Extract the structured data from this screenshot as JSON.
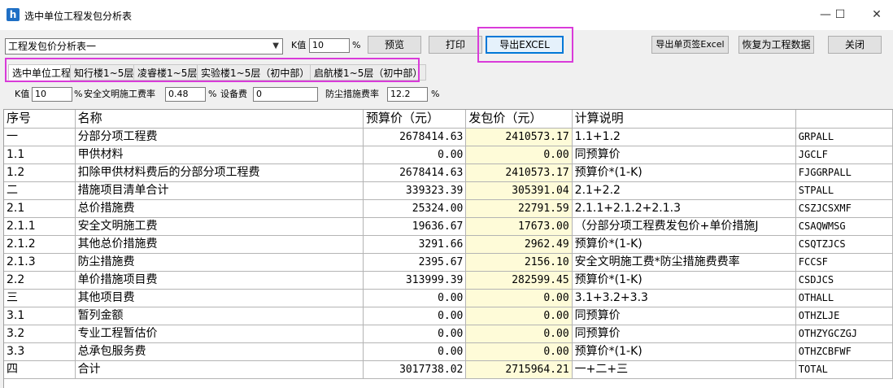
{
  "window": {
    "title": "选中单位工程发包分析表",
    "minimize": "—",
    "maximize": "☐",
    "close": "✕"
  },
  "toolbar": {
    "select_value": "工程发包价分析表一",
    "k_label": "K值",
    "k_value": "10",
    "percent": "%",
    "preview": "预览",
    "print": "打印",
    "export_excel": "导出EXCEL",
    "export_single_excel": "导出单页签Excel",
    "restore": "恢复为工程数据",
    "close": "关闭"
  },
  "tabs": [
    {
      "label": "选中单位工程",
      "active": true
    },
    {
      "label": "知行楼1~5层",
      "active": false
    },
    {
      "label": "凌睿楼1~5层",
      "active": false
    },
    {
      "label": "实验楼1~5层（初中部）",
      "active": false
    },
    {
      "label": "启航楼1~5层（初中部）",
      "active": false
    }
  ],
  "params": {
    "k_label": "K值",
    "k_value": "10",
    "percent": "%",
    "safety_label": "安全文明施工费率",
    "safety_value": "0.48",
    "equip_label": "设备费",
    "equip_value": "0",
    "dust_label": "防尘措施费率",
    "dust_value": "12.2"
  },
  "table": {
    "headers": [
      "序号",
      "名称",
      "预算价（元）",
      "发包价（元）",
      "计算说明",
      ""
    ],
    "rows": [
      [
        "一",
        "分部分项工程费",
        "2678414.63",
        "2410573.17",
        "1.1+1.2",
        "GRPALL"
      ],
      [
        "1.1",
        "甲供材料",
        "0.00",
        "0.00",
        "同预算价",
        "JGCLF"
      ],
      [
        "1.2",
        "扣除甲供材料费后的分部分项工程费",
        "2678414.63",
        "2410573.17",
        "预算价*(1-K)",
        "FJGGRPALL"
      ],
      [
        "二",
        "措施项目清单合计",
        "339323.39",
        "305391.04",
        "2.1+2.2",
        "STPALL"
      ],
      [
        "2.1",
        "总价措施费",
        "25324.00",
        "22791.59",
        "2.1.1+2.1.2+2.1.3",
        "CSZJCSXMF"
      ],
      [
        "2.1.1",
        "安全文明施工费",
        "19636.67",
        "17673.00",
        "（分部分项工程费发包价+单价措施J",
        "CSAQWMSG"
      ],
      [
        "2.1.2",
        "其他总价措施费",
        "3291.66",
        "2962.49",
        "预算价*(1-K)",
        "CSQTZJCS"
      ],
      [
        "2.1.3",
        "防尘措施费",
        "2395.67",
        "2156.10",
        "安全文明施工费*防尘措施费费率",
        "FCCSF"
      ],
      [
        "2.2",
        "单价措施项目费",
        "313999.39",
        "282599.45",
        "预算价*(1-K)",
        "CSDJCS"
      ],
      [
        "三",
        "其他项目费",
        "0.00",
        "0.00",
        "3.1+3.2+3.3",
        "OTHALL"
      ],
      [
        "3.1",
        "暂列金额",
        "0.00",
        "0.00",
        "同预算价",
        "OTHZLJE"
      ],
      [
        "3.2",
        "专业工程暂估价",
        "0.00",
        "0.00",
        "同预算价",
        "OTHZYGCZGJ"
      ],
      [
        "3.3",
        "总承包服务费",
        "0.00",
        "0.00",
        "预算价*(1-K)",
        "OTHZCBFWF"
      ],
      [
        "四",
        "合计",
        "3017738.02",
        "2715964.21",
        "一+二+三",
        "TOTAL"
      ]
    ]
  },
  "colors": {
    "highlight_box": "#d93bd9",
    "bao_column_bg": "#fefbd8",
    "focus_border": "#0078d7"
  }
}
